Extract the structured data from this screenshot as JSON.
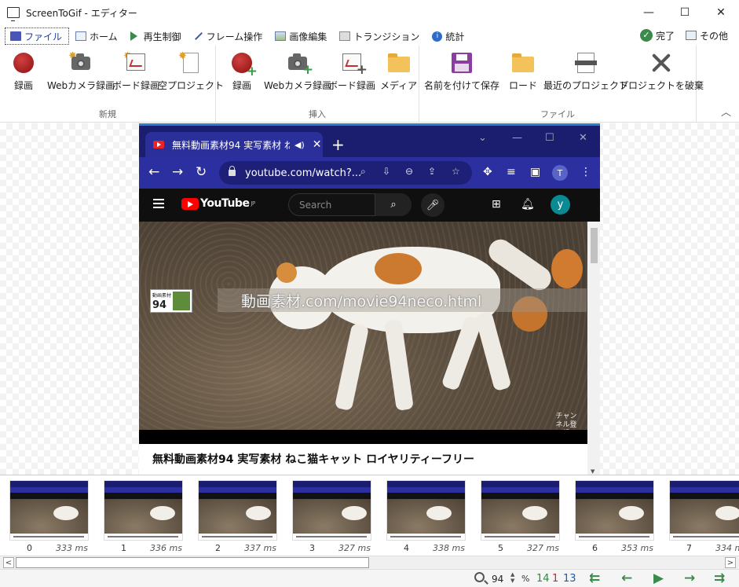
{
  "window": {
    "title": "ScreenToGif - エディター",
    "minimize_glyph": "—",
    "maximize_glyph": "☐",
    "close_glyph": "✕"
  },
  "tabs": [
    {
      "label": "ファイル",
      "icon": "save-icon",
      "active": true
    },
    {
      "label": "ホーム",
      "icon": "home-icon"
    },
    {
      "label": "再生制御",
      "icon": "play-icon"
    },
    {
      "label": "フレーム操作",
      "icon": "pen-icon"
    },
    {
      "label": "画像編集",
      "icon": "image-icon"
    },
    {
      "label": "トランジション",
      "icon": "transition-icon"
    },
    {
      "label": "統計",
      "icon": "info-icon"
    }
  ],
  "tabs_right": [
    {
      "label": "完了",
      "icon": "check-icon"
    },
    {
      "label": "その他",
      "icon": "options-icon"
    }
  ],
  "ribbon": {
    "groups": [
      {
        "label": "新規",
        "buttons": [
          "録画",
          "Webカメラ録画",
          "ボード録画",
          "空プロジェクト"
        ]
      },
      {
        "label": "挿入",
        "buttons": [
          "録画",
          "Webカメラ録画",
          "ボード録画",
          "メディア"
        ]
      },
      {
        "label": "ファイル",
        "buttons": [
          "名前を付けて保存",
          "ロード",
          "最近のプロジェクト",
          "プロジェクトを破棄"
        ]
      }
    ],
    "collapse_glyph": "︿"
  },
  "browser": {
    "tab_title": "無料動画素材94 実写素材 ね",
    "tab_close": "✕",
    "new_tab": "+",
    "url": "youtube.com/watch?...",
    "profile_initial": "T",
    "yt_logo": "YouTube",
    "yt_region": "JP",
    "search_placeholder": "Search",
    "account_initial": "y",
    "video_watermark": "動画素材.com/movie94neco.html",
    "watermark_logo_text": "動画素材",
    "watermark_logo_number": "94",
    "subscribe_text": "チャンネル登録",
    "video_title": "無料動画素材94 実写素材 ねこ猫キャット ロイヤリティーフリー"
  },
  "frames": [
    {
      "index": "0",
      "delay": "333 ms"
    },
    {
      "index": "1",
      "delay": "336 ms"
    },
    {
      "index": "2",
      "delay": "337 ms"
    },
    {
      "index": "3",
      "delay": "327 ms"
    },
    {
      "index": "4",
      "delay": "338 ms"
    },
    {
      "index": "5",
      "delay": "327 ms"
    },
    {
      "index": "6",
      "delay": "353 ms"
    },
    {
      "index": "7",
      "delay": "334 m"
    }
  ],
  "status": {
    "zoom": "94",
    "percent": "%",
    "selected_count": "14",
    "current_frame": "1",
    "total_frames": "13"
  },
  "colors": {
    "accent": "#1e3c9e",
    "record_red": "#b52020",
    "nav_green": "#3a8a4a",
    "browser_chrome": "#2b2fa0"
  }
}
